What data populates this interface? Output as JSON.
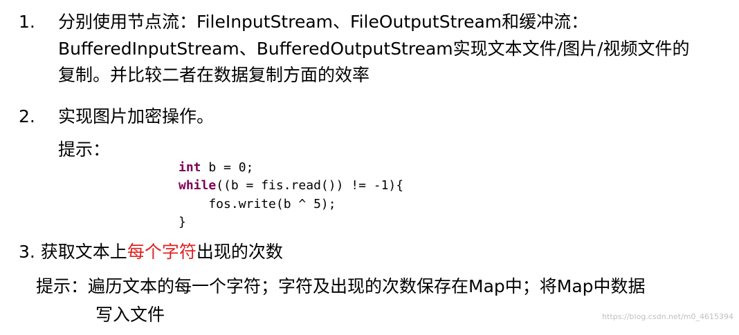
{
  "item1": {
    "num": "1.",
    "line1": "分别使用节点流：FileInputStream、FileOutputStream和缓冲流：",
    "line2": "BufferedInputStream、BufferedOutputStream实现文本文件/图片/视频文件的",
    "line3": "复制。并比较二者在数据复制方面的效率"
  },
  "item2": {
    "num": "2.",
    "line1": "实现图片加密操作。",
    "hint_label": "提示：",
    "code": {
      "l1_kw": "int",
      "l1_rest": " b = 0;",
      "l2_kw": "while",
      "l2_rest": "((b = fis.read()) != -1){",
      "l3": "    fos.write(b ^ 5);",
      "l4": "}"
    }
  },
  "item3": {
    "prefix": "3. 获取文本上",
    "highlight": "每个字符",
    "suffix": "出现的次数",
    "hint_line1": "提示：遍历文本的每一个字符；字符及出现的次数保存在Map中；将Map中数据",
    "hint_line2": "写入文件",
    "highlight_color": "#e02020"
  },
  "watermark": "https://blog.csdn.net/m0_4615394"
}
